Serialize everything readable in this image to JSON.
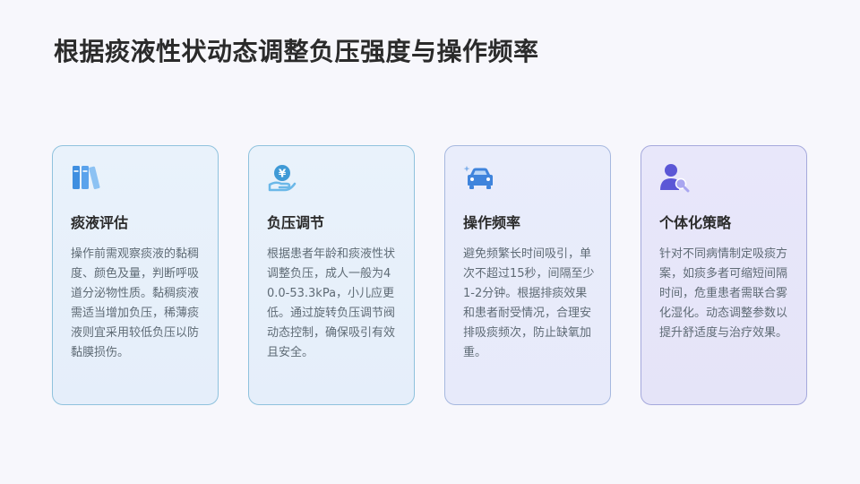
{
  "slide": {
    "title": "根据痰液性状动态调整负压强度与操作频率"
  },
  "cards": [
    {
      "icon": "books-icon",
      "title": "痰液评估",
      "text": "操作前需观察痰液的黏稠度、颜色及量，判断呼吸道分泌物性质。黏稠痰液需适当增加负压，稀薄痰液则宜采用较低负压以防黏膜损伤。"
    },
    {
      "icon": "yen-hand-icon",
      "title": "负压调节",
      "text": "根据患者年龄和痰液性状调整负压，成人一般为40.0-53.3kPa，小儿应更低。通过旋转负压调节阀动态控制，确保吸引有效且安全。"
    },
    {
      "icon": "car-icon",
      "title": "操作频率",
      "text": "避免频繁长时间吸引，单次不超过15秒，间隔至少1-2分钟。根据排痰效果和患者耐受情况，合理安排吸痰频次，防止缺氧加重。"
    },
    {
      "icon": "user-search-icon",
      "title": "个体化策略",
      "text": "针对不同病情制定吸痰方案，如痰多者可缩短间隔时间，危重患者需联合雾化湿化。动态调整参数以提升舒适度与治疗效果。"
    }
  ]
}
